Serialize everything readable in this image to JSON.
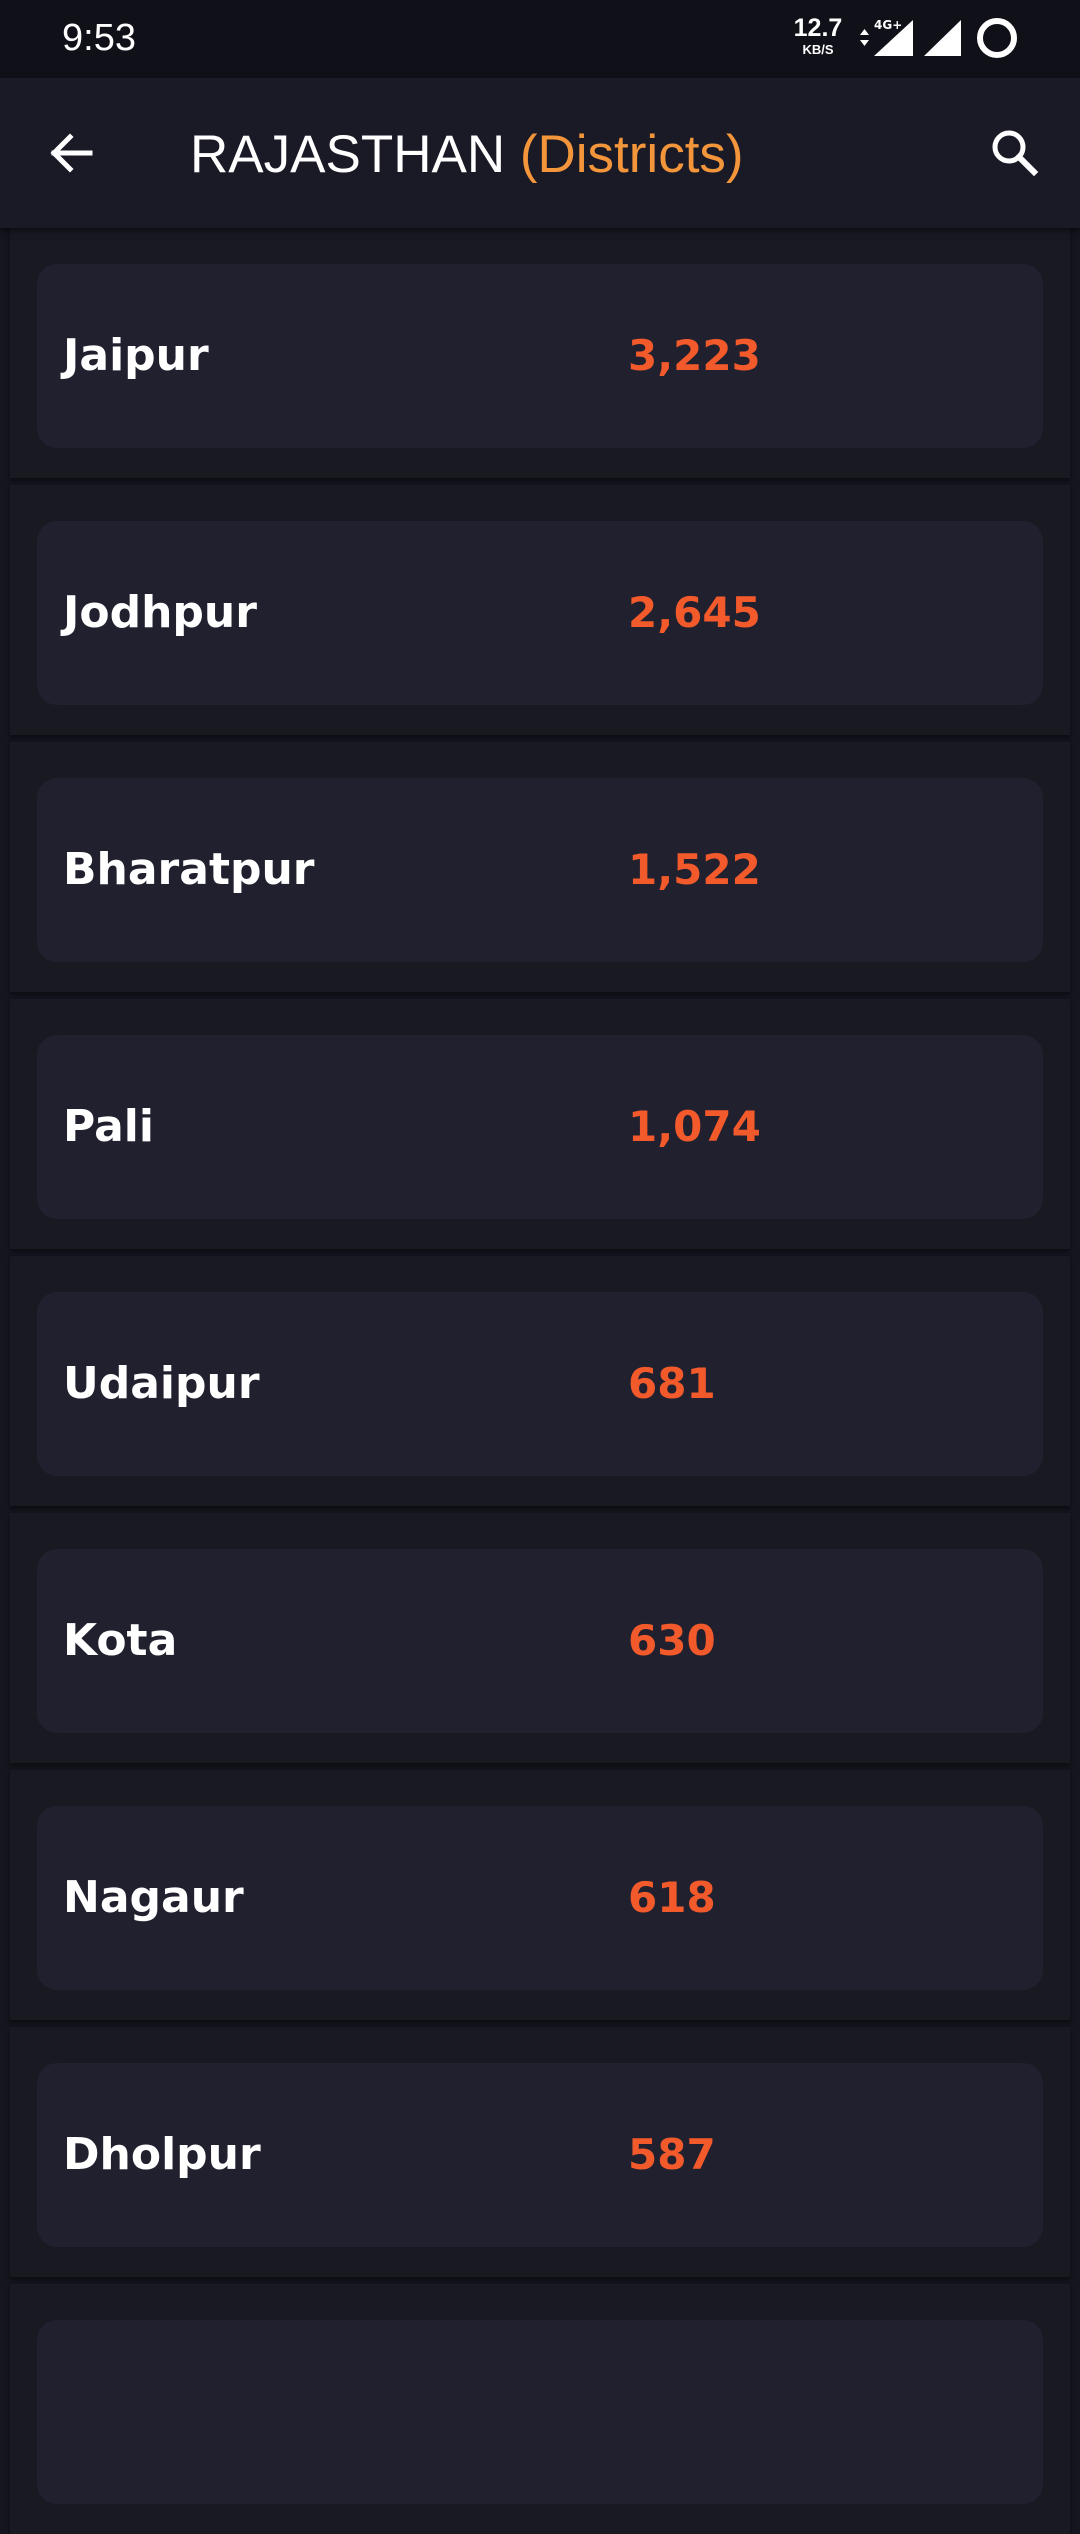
{
  "status_bar": {
    "time": "9:53",
    "net_speed_value": "12.7",
    "net_speed_unit": "KB/S",
    "network_type": "4G+",
    "icons": [
      "data-arrows-icon",
      "signal-4g-icon",
      "signal-icon",
      "battery-ring-icon"
    ]
  },
  "header": {
    "title": "RAJASTHAN",
    "subtitle": "(Districts)",
    "back_icon": "arrow-back-icon",
    "search_icon": "search-icon"
  },
  "districts": [
    {
      "name": "Jaipur",
      "count": "3,223"
    },
    {
      "name": "Jodhpur",
      "count": "2,645"
    },
    {
      "name": "Bharatpur",
      "count": "1,522"
    },
    {
      "name": "Pali",
      "count": "1,074"
    },
    {
      "name": "Udaipur",
      "count": "681"
    },
    {
      "name": "Kota",
      "count": "630"
    },
    {
      "name": "Nagaur",
      "count": "618"
    },
    {
      "name": "Dholpur",
      "count": "587"
    },
    {
      "name": "",
      "count": ""
    }
  ],
  "colors": {
    "background": "#15151f",
    "app_bar": "#1a1a26",
    "card": "#20202f",
    "title_accent": "#f3953a",
    "count": "#f35a2b",
    "text": "#ffffff"
  }
}
